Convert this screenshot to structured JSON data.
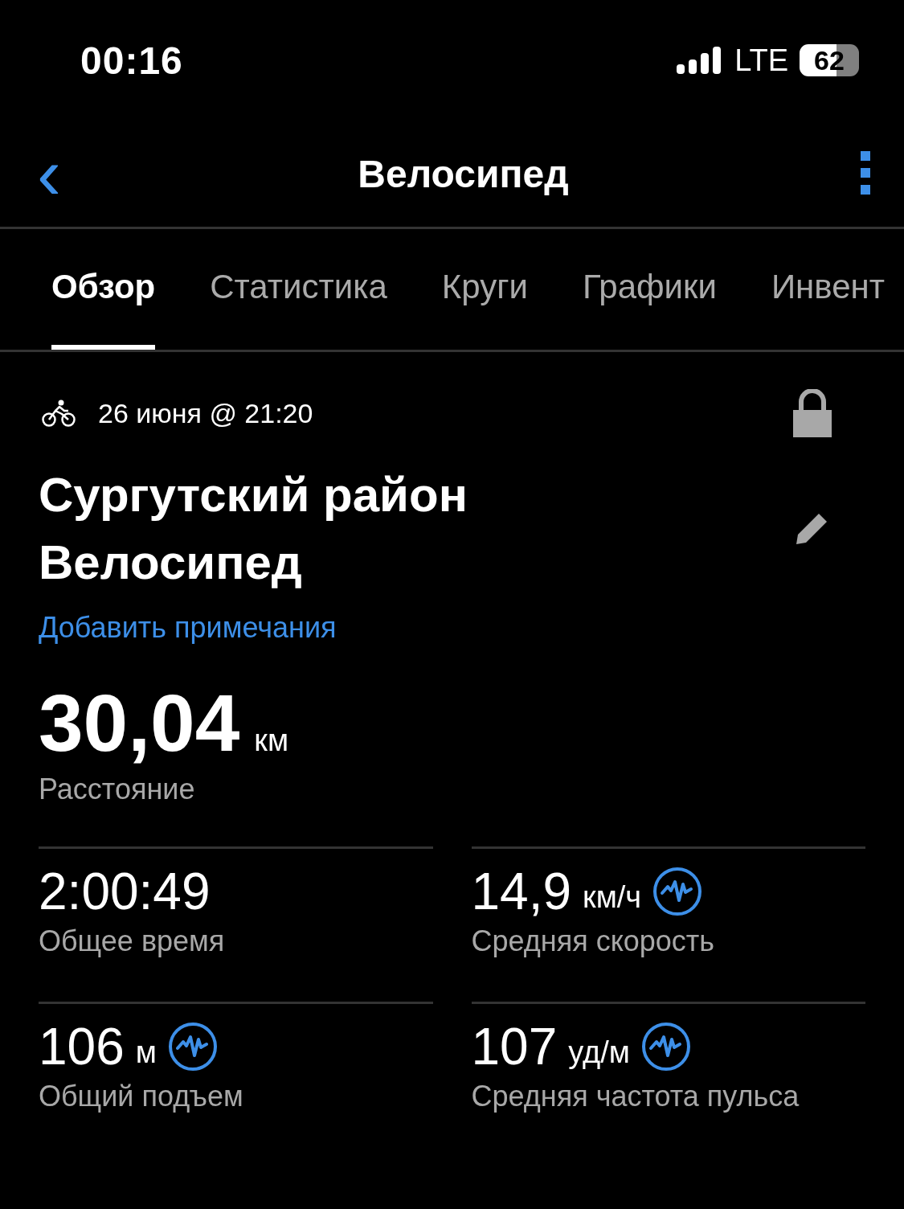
{
  "status_bar": {
    "time": "00:16",
    "network": "LTE",
    "battery": "62"
  },
  "header": {
    "back": "‹",
    "title": "Велосипед"
  },
  "tabs": [
    {
      "label": "Обзор",
      "selected": true
    },
    {
      "label": "Статистика",
      "selected": false
    },
    {
      "label": "Круги",
      "selected": false
    },
    {
      "label": "Графики",
      "selected": false
    },
    {
      "label": "Инвент",
      "selected": false
    }
  ],
  "activity": {
    "date": "26 июня @ 21:20",
    "locked": true,
    "title_lines": [
      "Сургутский район",
      "Велосипед"
    ],
    "add_notes": "Добавить примечания"
  },
  "distance": {
    "value": "30,04",
    "unit": "км",
    "label": "Расстояние"
  },
  "stats": [
    {
      "value": "2:00:49",
      "label": "Общее время",
      "insight": false
    },
    {
      "value": "14,9",
      "unit": "км/ч",
      "label": "Средняя скорость",
      "insight": true
    },
    {
      "value": "106",
      "unit": "м",
      "label": "Общий подъем",
      "insight": true
    },
    {
      "value": "107",
      "unit": "уд/м",
      "label": "Средняя частота пульса",
      "insight": true
    }
  ]
}
